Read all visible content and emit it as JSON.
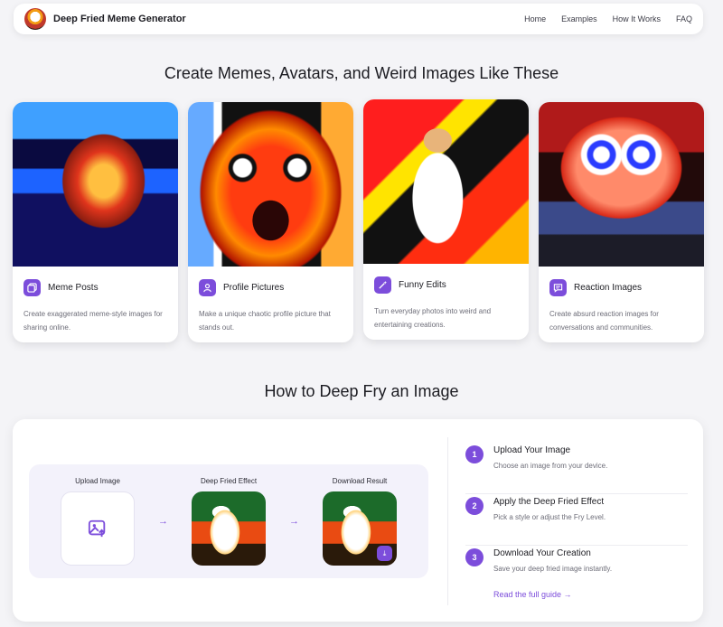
{
  "nav": {
    "brand": "Deep Fried Meme Generator",
    "links": [
      "Home",
      "Examples",
      "How It Works",
      "FAQ"
    ]
  },
  "examples": {
    "title": "Create Memes, Avatars, and Weird Images Like These",
    "cards": [
      {
        "title": "Meme Posts",
        "desc": "Create exaggerated meme-style images for sharing online.",
        "icon": "gallery-icon"
      },
      {
        "title": "Profile Pictures",
        "desc": "Make a unique chaotic profile picture that stands out.",
        "icon": "user-icon"
      },
      {
        "title": "Funny Edits",
        "desc": "Turn everyday photos into weird and entertaining creations.",
        "icon": "magic-wand-icon"
      },
      {
        "title": "Reaction Images",
        "desc": "Create absurd reaction images for conversations and communities.",
        "icon": "chat-icon"
      }
    ]
  },
  "howto": {
    "title": "How to Deep Fry an Image",
    "demo": {
      "upload_label": "Upload Image",
      "fried_label": "Deep Fried Effect",
      "download_label": "Download Result"
    },
    "steps": [
      {
        "num": "1",
        "title": "Upload Your Image",
        "desc": "Choose an image from your device."
      },
      {
        "num": "2",
        "title": "Apply the Deep Fried Effect",
        "desc": "Pick a style or adjust the Fry Level."
      },
      {
        "num": "3",
        "title": "Download Your Creation",
        "desc": "Save your deep fried image instantly."
      }
    ],
    "guide_link": "Read the full guide →"
  },
  "colors": {
    "accent": "#7c4ddb",
    "background": "#f4f4f7"
  }
}
